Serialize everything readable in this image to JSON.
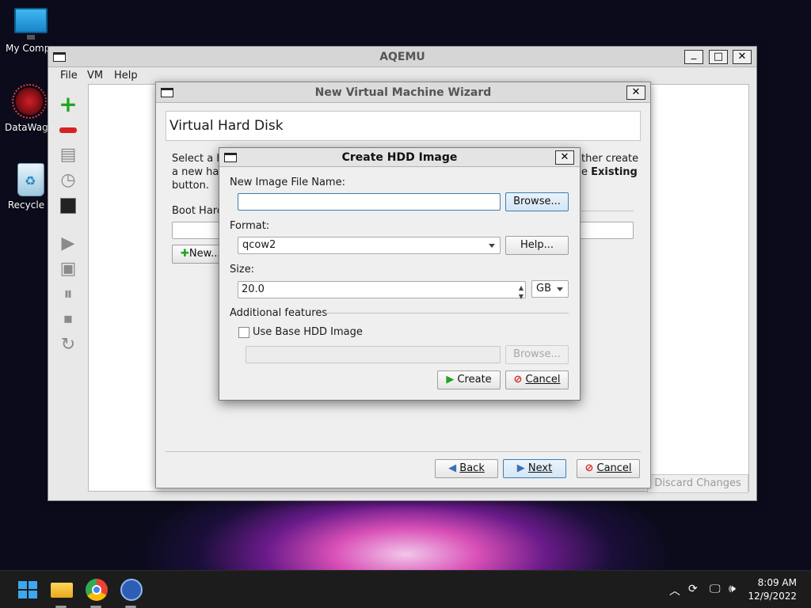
{
  "desktop": {
    "icons": [
      {
        "label": "My Compu",
        "icon": "computer-icon"
      },
      {
        "label": "DataWago",
        "icon": "datawagon-icon"
      },
      {
        "label": "Recycle B",
        "icon": "recycle-bin-icon"
      }
    ]
  },
  "aqemu": {
    "title": "AQEMU",
    "menu": [
      "File",
      "VM",
      "Help"
    ],
    "discard_label": "Discard Changes",
    "controls": {
      "minimize": "_",
      "maximize": "□",
      "close": "✕"
    }
  },
  "wizard": {
    "title": "New Virtual Machine Wizard",
    "page_title": "Virtual Hard Disk",
    "desc_left_1": "Select a h",
    "desc_left_2": "a new har",
    "desc_left_3": "button.",
    "desc_right_1": "ther create",
    "desc_right_2a": "e ",
    "desc_right_2b": "Existing",
    "boot_label": "Boot Hard",
    "new_label": "New...",
    "back_label": "Back",
    "next_label": "Next",
    "cancel_label": "Cancel",
    "close": "✕"
  },
  "hdd_dialog": {
    "title": "Create HDD Image",
    "close": "✕",
    "file_name_label": "New Image File Name:",
    "file_name_value": "",
    "browse_label": "Browse...",
    "format_label": "Format:",
    "format_value": "qcow2",
    "help_label": "Help...",
    "size_label": "Size:",
    "size_value": "20.0",
    "size_unit": "GB",
    "additional_label": "Additional features",
    "use_base_label": "Use Base HDD Image",
    "use_base_checked": false,
    "base_path_value": "",
    "base_browse_label": "Browse...",
    "create_label": "Create",
    "cancel_label": "Cancel"
  },
  "taskbar": {
    "apps": [
      "start-icon",
      "file-explorer-icon",
      "chrome-icon",
      "network-app-icon"
    ],
    "time": "8:09 AM",
    "date": "12/9/2022"
  },
  "colors": {
    "accent": "#3c7fb1",
    "add": "#1fa51f",
    "remove": "#d62222"
  }
}
